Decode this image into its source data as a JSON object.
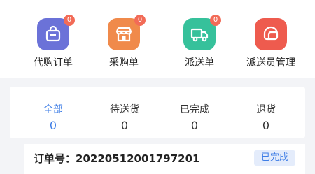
{
  "shortcuts": [
    {
      "label": "代购订单",
      "badge": "0",
      "color": "#6b72d8",
      "icon": "bag-icon"
    },
    {
      "label": "采购单",
      "badge": "0",
      "color": "#f08a4b",
      "icon": "store-icon"
    },
    {
      "label": "派送单",
      "badge": "0",
      "color": "#36c19b",
      "icon": "truck-icon"
    },
    {
      "label": "派送员管理",
      "badge": "0",
      "color": "#ee5b4e",
      "icon": "helmet-icon"
    }
  ],
  "tabs": [
    {
      "label": "全部",
      "count": "0",
      "active": true
    },
    {
      "label": "待送货",
      "count": "0",
      "active": false
    },
    {
      "label": "已完成",
      "count": "0",
      "active": false
    },
    {
      "label": "退货",
      "count": "0",
      "active": false
    }
  ],
  "order": {
    "number_label": "订单号：",
    "number": "20220512001797201",
    "status": "已完成"
  },
  "colors": {
    "accent": "#3f7ee6",
    "badge": "#f26b57",
    "background": "#f3f4f7"
  }
}
